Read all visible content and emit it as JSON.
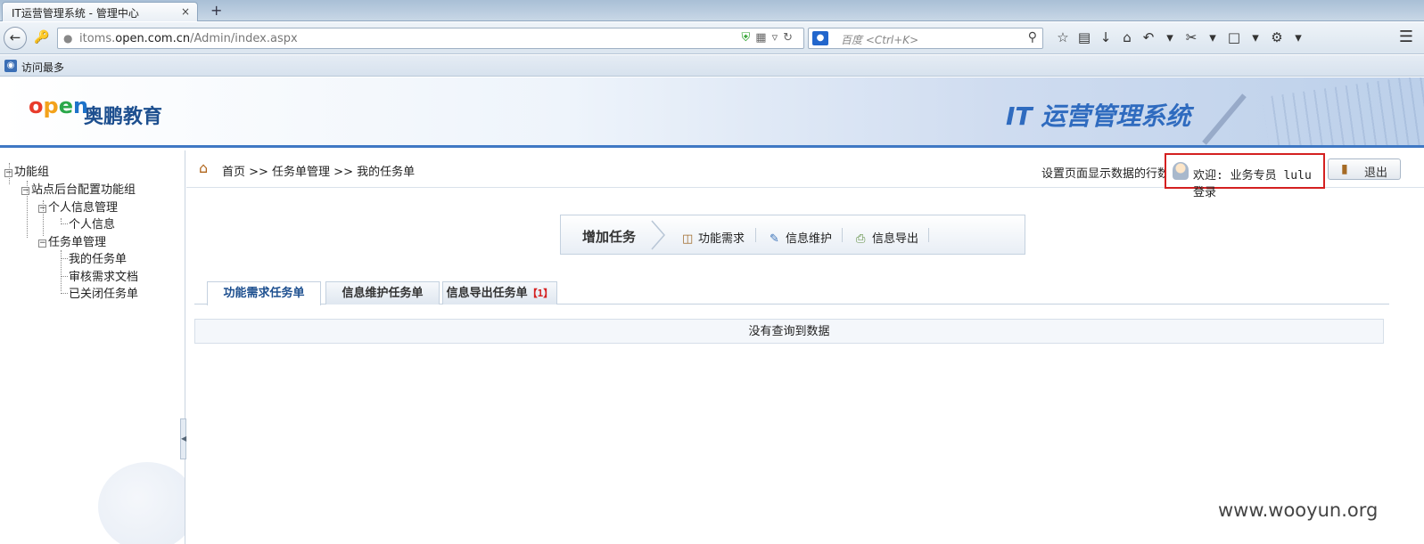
{
  "browser": {
    "tab_title": "IT运营管理系统 - 管理中心",
    "tab_close": "×",
    "new_tab": "+",
    "url_host_prefix": "itoms.",
    "url_host_main": "open.com.cn",
    "url_path": "/Admin/index.aspx",
    "search_engine_label": "百度",
    "search_placeholder": "百度 <Ctrl+K>",
    "bookmark_label": "访问最多"
  },
  "banner": {
    "logo_letters": [
      "o",
      "p",
      "e",
      "n"
    ],
    "logo_text": "奥鹏教育",
    "system_title": "IT 运营管理系统"
  },
  "tree": {
    "root": "功能组",
    "group": "站点后台配置功能组",
    "personal_mgmt": "个人信息管理",
    "personal_info": "个人信息",
    "task_mgmt": "任务单管理",
    "my_tasks": "我的任务单",
    "review_docs": "审核需求文档",
    "closed_tasks": "已关闭任务单"
  },
  "header": {
    "breadcrumb": "首页 >> 任务单管理 >> 我的任务单",
    "row_setting": "设置页面显示数据的行数",
    "welcome": "欢迎: 业务专员 lulu 登录",
    "logout": "退出"
  },
  "actions": {
    "add_task": "增加任务",
    "func_req": "功能需求",
    "info_maint": "信息维护",
    "info_export": "信息导出"
  },
  "tabs": {
    "tab1": "功能需求任务单",
    "tab2": "信息维护任务单",
    "tab3": "信息导出任务单",
    "tab3_badge": "【1】"
  },
  "table": {
    "empty_message": "没有查询到数据"
  },
  "watermark": "www.wooyun.org"
}
